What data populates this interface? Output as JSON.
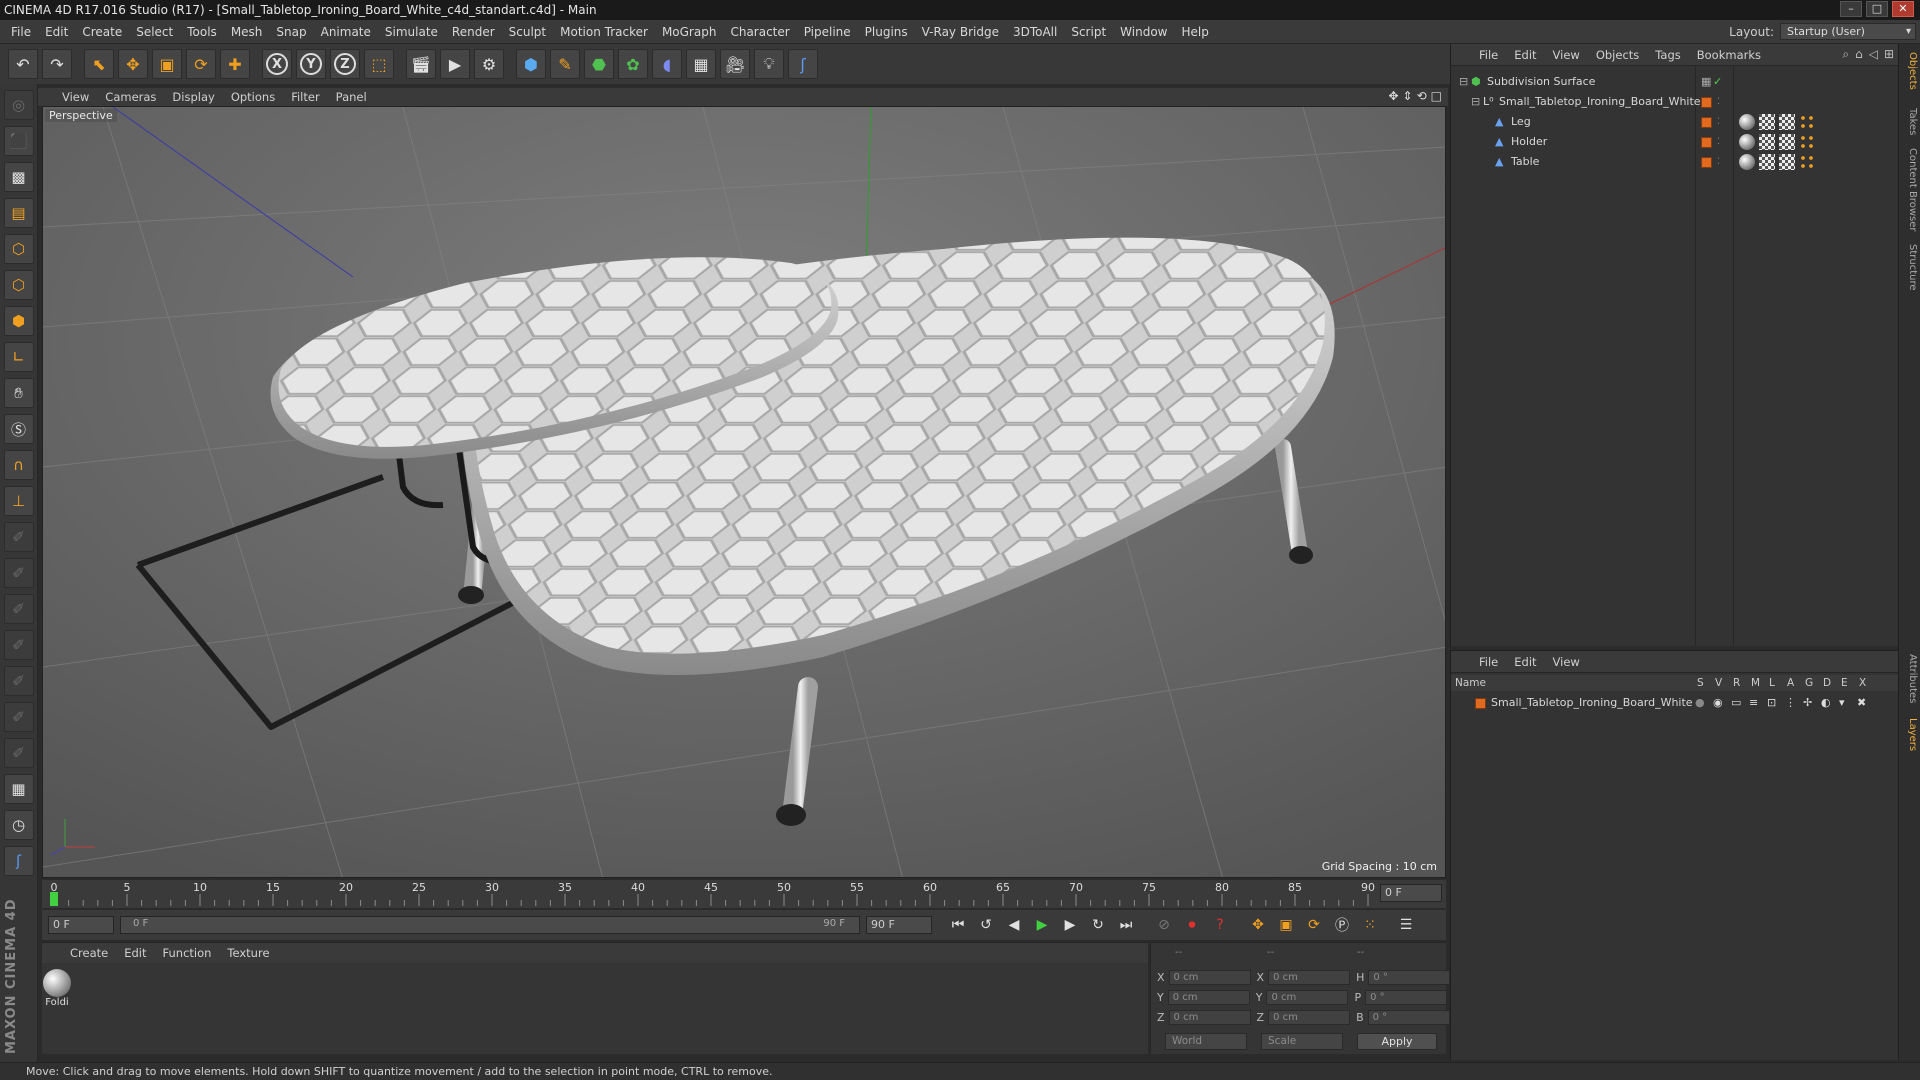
{
  "window": {
    "title": "CINEMA 4D R17.016 Studio (R17) - [Small_Tabletop_Ironing_Board_White_c4d_standart.c4d] - Main",
    "min_glyph": "–",
    "max_glyph": "□",
    "close_glyph": "✕"
  },
  "menubar": {
    "items": [
      "File",
      "Edit",
      "Create",
      "Select",
      "Tools",
      "Mesh",
      "Snap",
      "Animate",
      "Simulate",
      "Render",
      "Sculpt",
      "Motion Tracker",
      "MoGraph",
      "Character",
      "Pipeline",
      "Plugins",
      "V-Ray Bridge",
      "3DToAll",
      "Script",
      "Window",
      "Help"
    ],
    "layout_label": "Layout:",
    "layout_value": "Startup (User)"
  },
  "toolbar": {
    "undo": "↶",
    "redo": "↷",
    "x": "X",
    "y": "Y",
    "z": "Z"
  },
  "viewport": {
    "menu": [
      "View",
      "Cameras",
      "Display",
      "Options",
      "Filter",
      "Panel"
    ],
    "label": "Perspective",
    "grid_spacing": "Grid Spacing : 10 cm"
  },
  "timeline": {
    "ticks": [
      "0",
      "5",
      "10",
      "15",
      "20",
      "25",
      "30",
      "35",
      "40",
      "45",
      "50",
      "55",
      "60",
      "65",
      "70",
      "75",
      "80",
      "85",
      "90"
    ],
    "current_frame": "0 F",
    "start_field": "0 F",
    "range_start": "0 F",
    "range_end": "90 F",
    "end_field": "90 F"
  },
  "materials": {
    "menu": [
      "Create",
      "Edit",
      "Function",
      "Texture"
    ],
    "items": [
      {
        "label": "Foldi"
      }
    ]
  },
  "coords": {
    "headers": [
      "--",
      "--",
      "--"
    ],
    "rows": [
      {
        "a": "X",
        "av": "0 cm",
        "b": "X",
        "bv": "0 cm",
        "c": "H",
        "cv": "0 °"
      },
      {
        "a": "Y",
        "av": "0 cm",
        "b": "Y",
        "bv": "0 cm",
        "c": "P",
        "cv": "0 °"
      },
      {
        "a": "Z",
        "av": "0 cm",
        "b": "Z",
        "bv": "0 cm",
        "c": "B",
        "cv": "0 °"
      }
    ],
    "world": "World",
    "scale": "Scale",
    "apply": "Apply"
  },
  "objects": {
    "menu": [
      "File",
      "Edit",
      "View",
      "Objects",
      "Tags",
      "Bookmarks"
    ],
    "tree": [
      {
        "name": "Subdivision Surface"
      },
      {
        "name": "Small_Tabletop_Ironing_Board_White"
      },
      {
        "name": "Leg"
      },
      {
        "name": "Holder"
      },
      {
        "name": "Table"
      }
    ]
  },
  "layers": {
    "menu": [
      "File",
      "Edit",
      "View"
    ],
    "header_name": "Name",
    "header_cols": [
      "S",
      "V",
      "R",
      "M",
      "L",
      "A",
      "G",
      "D",
      "E",
      "X"
    ],
    "rows": [
      {
        "name": "Small_Tabletop_Ironing_Board_White"
      }
    ]
  },
  "right_tabs": [
    "Objects",
    "Takes",
    "Content Browser",
    "Structure",
    "Attributes",
    "Layers"
  ],
  "status": "Move: Click and drag to move elements. Hold down SHIFT to quantize movement / add to the selection in point mode, CTRL to remove.",
  "brand": "MAXON CINEMA 4D",
  "colors": {
    "accent": "#f0a020",
    "layer_color": "#e06a20",
    "play": "#40d040"
  }
}
